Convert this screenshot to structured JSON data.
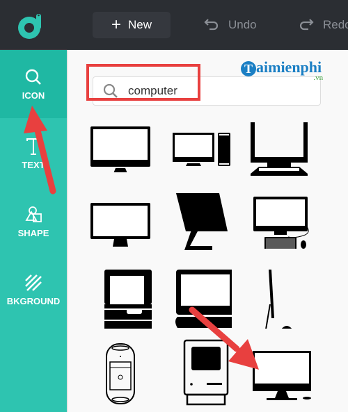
{
  "toolbar": {
    "new_label": "New",
    "undo_label": "Undo",
    "redo_label": "Redo"
  },
  "sidebar": {
    "items": [
      {
        "label": "ICON",
        "icon": "search-icon",
        "active": true
      },
      {
        "label": "TEXT",
        "icon": "text-icon",
        "active": false
      },
      {
        "label": "SHAPE",
        "icon": "shape-icon",
        "active": false
      },
      {
        "label": "BKGROUND",
        "icon": "background-icon",
        "active": false
      }
    ]
  },
  "search": {
    "value": "computer"
  },
  "watermark": {
    "brand": "aimienphi",
    "suffix": ".vn"
  },
  "results": [
    {
      "name": "imac-monitor"
    },
    {
      "name": "desktop-with-tower"
    },
    {
      "name": "crt-terminal"
    },
    {
      "name": "flat-monitor"
    },
    {
      "name": "all-in-one-side"
    },
    {
      "name": "desktop-keyboard-mouse"
    },
    {
      "name": "retro-computer"
    },
    {
      "name": "monitor-keyboard"
    },
    {
      "name": "imac-side-view"
    },
    {
      "name": "mac-pro-tower"
    },
    {
      "name": "classic-macintosh"
    },
    {
      "name": "imac-with-mouse"
    }
  ],
  "colors": {
    "accent": "#2ec4b0",
    "accent_active": "#1fb8a3",
    "topbar": "#2b2e33",
    "annotation": "#e8403f"
  }
}
